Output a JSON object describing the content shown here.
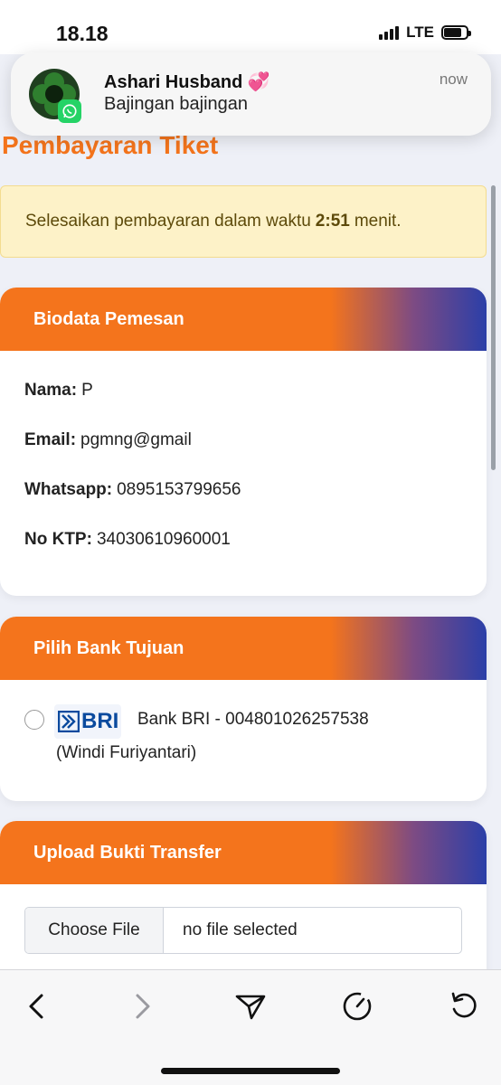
{
  "status_bar": {
    "time": "18.18",
    "network": "LTE"
  },
  "notification": {
    "sender": "Ashari Husband 💞",
    "message": "Bajingan bajingan",
    "time": "now",
    "app_icon": "whatsapp-icon"
  },
  "page": {
    "title": "Pembayaran Tiket",
    "timer": {
      "prefix": "Selesaikan pembayaran dalam waktu",
      "value": "2:51",
      "suffix": "menit."
    }
  },
  "biodata": {
    "header": "Biodata Pemesan",
    "fields": [
      {
        "label": "Nama:",
        "value": "P"
      },
      {
        "label": "Email:",
        "value": "pgmng@gmail"
      },
      {
        "label": "Whatsapp:",
        "value": "0895153799656"
      },
      {
        "label": "No KTP:",
        "value": "34030610960001"
      }
    ]
  },
  "bank": {
    "header": "Pilih Bank Tujuan",
    "logo_text": "BRI",
    "line1": "Bank BRI - 004801026257538",
    "line2": "(Windi Furiyantari)",
    "selected": false
  },
  "upload": {
    "header": "Upload Bukti Transfer",
    "button_label": "Choose File",
    "status": "no file selected"
  },
  "toolbar": {
    "icons": [
      "back-icon",
      "forward-icon",
      "share-icon",
      "speed-icon",
      "reload-icon"
    ]
  },
  "colors": {
    "accent": "#f4741c",
    "gradient_end": "#2b3fa8",
    "timer_bg": "#fdf2c8"
  }
}
